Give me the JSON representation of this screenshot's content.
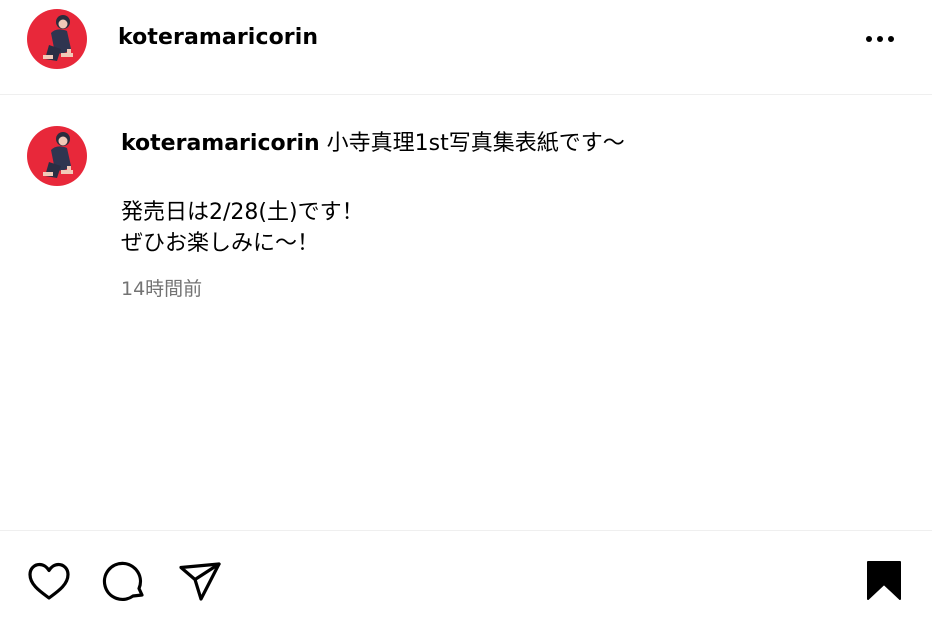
{
  "header": {
    "username": "koteramaricorin",
    "avatar_icon": "profile-photo",
    "more_icon": "more-horizontal-icon"
  },
  "caption": {
    "username": "koteramaricorin",
    "first_line": "小寺真理1st写真集表紙です〜",
    "lines": [
      "発売日は2/28(土)です！",
      "ぜひお楽しみに〜！"
    ],
    "timestamp": "14時間前"
  },
  "actions": {
    "like_icon": "heart-outline-icon",
    "comment_icon": "comment-outline-icon",
    "share_icon": "paper-plane-icon",
    "save_icon": "bookmark-filled-icon",
    "save_state": "saved"
  },
  "colors": {
    "avatar_background": "#e8283a",
    "text": "#000000",
    "secondary_text": "#737373",
    "divider": "#efefef"
  }
}
